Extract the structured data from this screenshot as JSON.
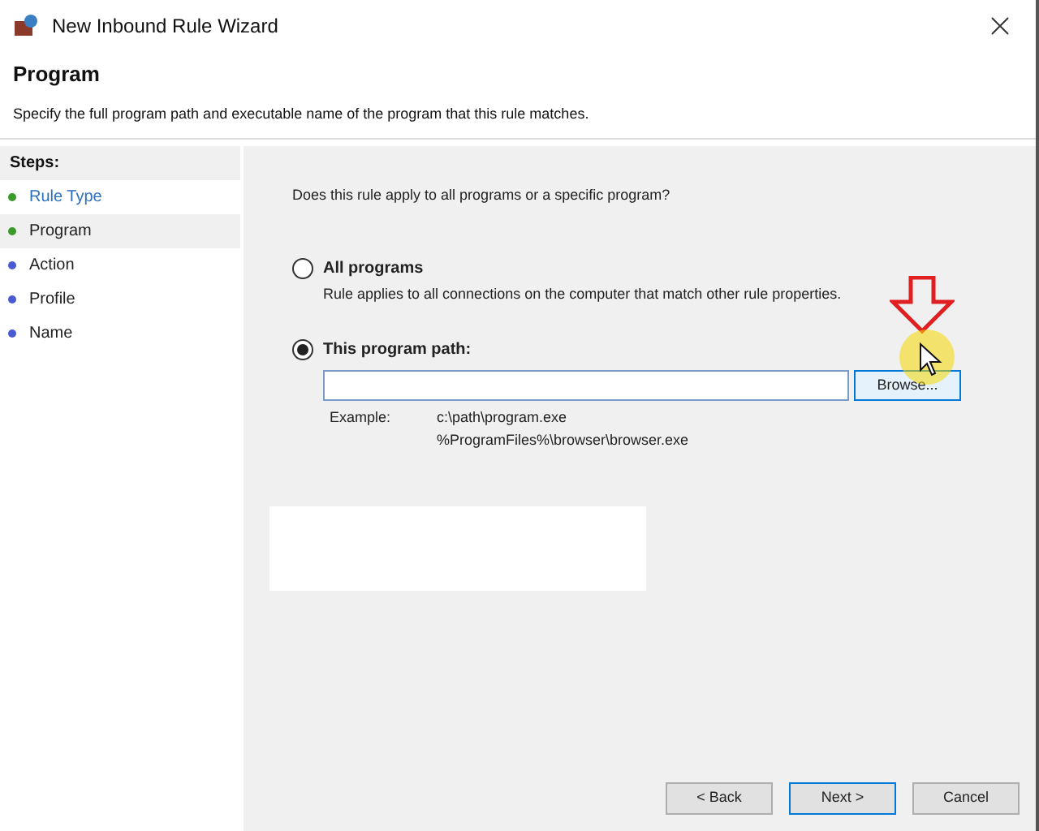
{
  "window": {
    "title": "New Inbound Rule Wizard"
  },
  "header": {
    "title": "Program",
    "description": "Specify the full program path and executable name of the program that this rule matches."
  },
  "steps": {
    "label": "Steps:",
    "items": [
      {
        "label": "Rule Type",
        "completed": true,
        "selected": false
      },
      {
        "label": "Program",
        "completed": true,
        "selected": true
      },
      {
        "label": "Action",
        "completed": false,
        "selected": false
      },
      {
        "label": "Profile",
        "completed": false,
        "selected": false
      },
      {
        "label": "Name",
        "completed": false,
        "selected": false
      }
    ]
  },
  "question": "Does this rule apply to all programs or a specific program?",
  "options": [
    {
      "label": "All programs",
      "description": "Rule applies to all connections on the computer that match other rule properties.",
      "selected": false
    },
    {
      "label": "This program path:",
      "selected": true
    }
  ],
  "browse_button": "Browse...",
  "example": {
    "label": "Example:",
    "lines": [
      "c:\\path\\program.exe",
      "%ProgramFiles%\\browser\\browser.exe"
    ]
  },
  "buttons": [
    {
      "label": "< Back",
      "default": false
    },
    {
      "label": "Next >",
      "default": true
    },
    {
      "label": "Cancel",
      "default": false
    }
  ]
}
